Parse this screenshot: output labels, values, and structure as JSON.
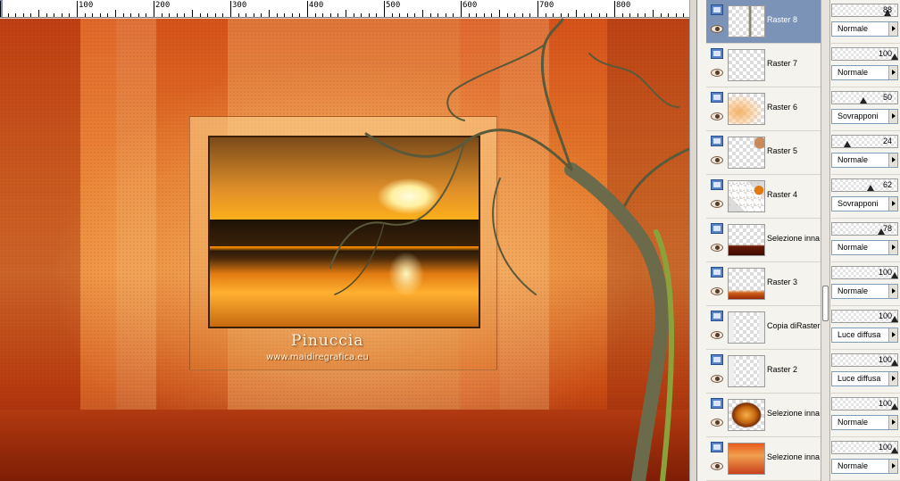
{
  "ruler": {
    "labels": [
      "100",
      "200",
      "300",
      "400",
      "500",
      "600",
      "700",
      "800"
    ]
  },
  "canvas": {
    "watermark_title": "Pinuccia",
    "watermark_url": "www.maidiregrafica.eu"
  },
  "layers": [
    {
      "name": "Raster 8",
      "opacity": "88",
      "blend": "Normale",
      "level": 0.88,
      "active": true,
      "thumb": "tree-branch"
    },
    {
      "name": "Raster 7",
      "opacity": "100",
      "blend": "Normale",
      "level": 1.0,
      "active": false,
      "thumb": "empty"
    },
    {
      "name": "Raster 6",
      "opacity": "50",
      "blend": "Sovrapponi",
      "level": 0.5,
      "active": false,
      "thumb": "warm-blur"
    },
    {
      "name": "Raster 5",
      "opacity": "24",
      "blend": "Normale",
      "level": 0.24,
      "active": false,
      "thumb": "face-small"
    },
    {
      "name": "Raster 4",
      "opacity": "62",
      "blend": "Sovrapponi",
      "level": 0.62,
      "active": false,
      "thumb": "orange-dots"
    },
    {
      "name": "Selezione inna",
      "opacity": "78",
      "blend": "Normale",
      "level": 0.78,
      "active": false,
      "thumb": "dark-floor"
    },
    {
      "name": "Raster 3",
      "opacity": "100",
      "blend": "Normale",
      "level": 1.0,
      "active": false,
      "thumb": "floor-strip"
    },
    {
      "name": "Copia diRaster",
      "opacity": "100",
      "blend": "Luce diffusa",
      "level": 1.0,
      "active": false,
      "thumb": "bars"
    },
    {
      "name": "Raster 2",
      "opacity": "100",
      "blend": "Luce diffusa",
      "level": 1.0,
      "active": false,
      "thumb": "bars"
    },
    {
      "name": "Selezione inna",
      "opacity": "100",
      "blend": "Normale",
      "level": 1.0,
      "active": false,
      "thumb": "orange-glow"
    },
    {
      "name": "Selezione inna",
      "opacity": "100",
      "blend": "Normale",
      "level": 1.0,
      "active": false,
      "thumb": "orange-red"
    }
  ],
  "colors": {
    "active_layer": "#7b93b7",
    "canvas_orange": "#e47a2c",
    "canvas_red": "#c94b14"
  },
  "icons": {
    "visibility": "layer-visibility-icon",
    "eye": "eye-icon",
    "dropdown": "chevron-right-icon"
  }
}
